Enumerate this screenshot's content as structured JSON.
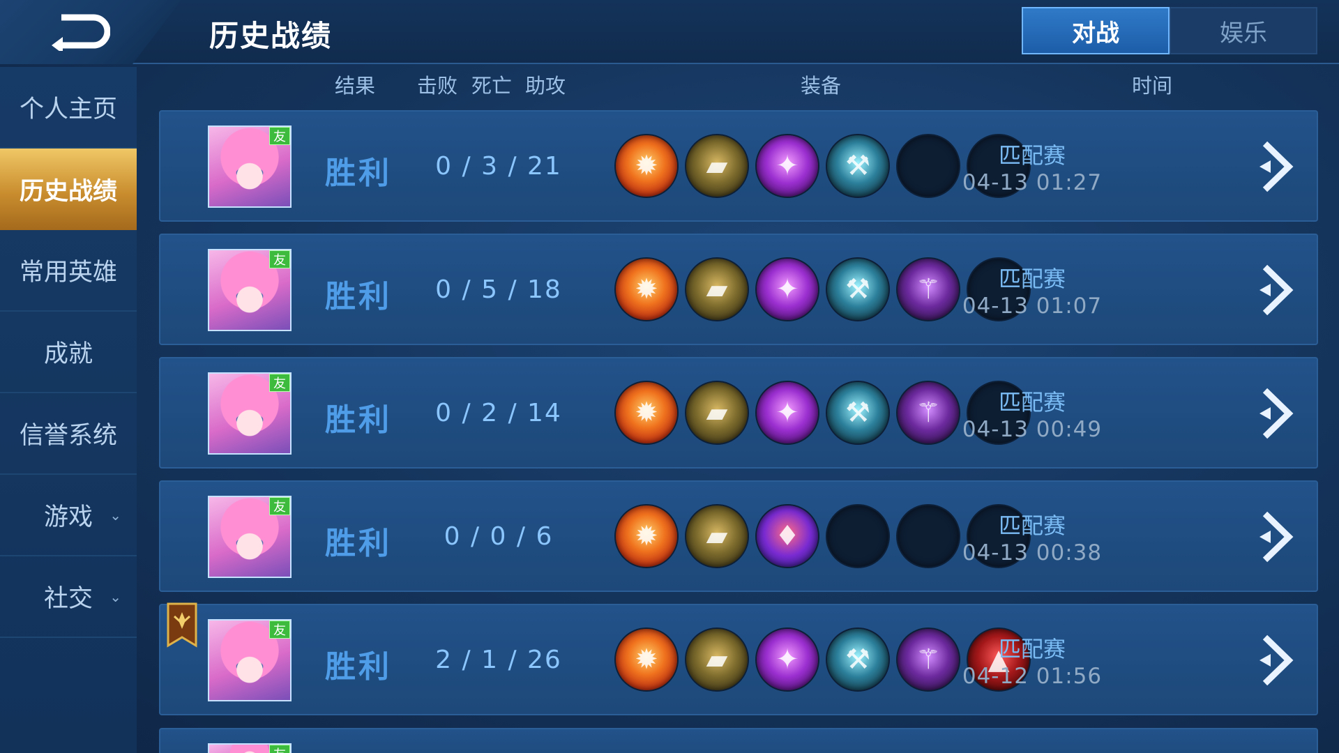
{
  "header": {
    "title": "历史战绩"
  },
  "tabs": [
    {
      "label": "对战",
      "active": true
    },
    {
      "label": "娱乐",
      "active": false
    }
  ],
  "sidebar": {
    "items": [
      {
        "label": "个人主页",
        "active": false,
        "has_chevron": false
      },
      {
        "label": "历史战绩",
        "active": true,
        "has_chevron": false
      },
      {
        "label": "常用英雄",
        "active": false,
        "has_chevron": false
      },
      {
        "label": "成就",
        "active": false,
        "has_chevron": false
      },
      {
        "label": "信誉系统",
        "active": false,
        "has_chevron": false
      },
      {
        "label": "游戏",
        "active": false,
        "has_chevron": true
      },
      {
        "label": "社交",
        "active": false,
        "has_chevron": true
      }
    ]
  },
  "columns": {
    "result": "结果",
    "kills": "击败",
    "deaths": "死亡",
    "assists": "助攻",
    "items": "装备",
    "time": "时间"
  },
  "friend_badge": "友",
  "matches": [
    {
      "result": "胜利",
      "kda": "0 / 3 / 21",
      "mode": "匹配赛",
      "time": "04-13  01:27",
      "mvp": false,
      "items": [
        "fire-orb",
        "boots",
        "purple-scepter",
        "ice-axe",
        "empty",
        "empty"
      ]
    },
    {
      "result": "胜利",
      "kda": "0 / 5 / 18",
      "mode": "匹配赛",
      "time": "04-13  01:07",
      "mvp": false,
      "items": [
        "fire-orb",
        "boots",
        "purple-scepter",
        "ice-axe",
        "dark-staff",
        "empty"
      ]
    },
    {
      "result": "胜利",
      "kda": "0 / 2 / 14",
      "mode": "匹配赛",
      "time": "04-13  00:49",
      "mvp": false,
      "items": [
        "fire-orb",
        "boots",
        "purple-scepter",
        "ice-axe",
        "dark-staff",
        "empty"
      ]
    },
    {
      "result": "胜利",
      "kda": "0 / 0 / 6",
      "mode": "匹配赛",
      "time": "04-13  00:38",
      "mvp": false,
      "items": [
        "fire-orb",
        "boots",
        "ruby-wand",
        "empty",
        "empty",
        "empty"
      ]
    },
    {
      "result": "胜利",
      "kda": "2 / 1 / 26",
      "mode": "匹配赛",
      "time": "04-12  01:56",
      "mvp": true,
      "items": [
        "fire-orb",
        "boots",
        "purple-scepter",
        "ice-axe",
        "dark-staff",
        "wizard-hat"
      ]
    }
  ],
  "item_styles": {
    "fire-orb": {
      "bg": "radial-gradient(circle at 50% 45%, #ffcf6a 0%, #f0731e 40%, #b3220f 80%, #5e0d06 100%)",
      "glyph": "✹"
    },
    "boots": {
      "bg": "radial-gradient(circle at 50% 45%, #d8b863 0%, #7b6a2c 45%, #3a3216 85%)",
      "glyph": "▰"
    },
    "purple-scepter": {
      "bg": "radial-gradient(circle at 50% 45%, #f39bff 0%, #9b2fd0 45%, #3f0c5e 90%)",
      "glyph": "✦"
    },
    "ice-axe": {
      "bg": "radial-gradient(circle at 50% 45%, #9ef3ff 0%, #2c7f9a 45%, #0d2a38 90%)",
      "glyph": "⚒"
    },
    "dark-staff": {
      "bg": "radial-gradient(circle at 50% 45%, #d38dff 0%, #6c2a9e 45%, #27103f 90%)",
      "glyph": "⚚"
    },
    "ruby-wand": {
      "bg": "radial-gradient(circle at 50% 45%, #ff6a86 0%, #7a2bd2 50%, #2b1a7a 90%)",
      "glyph": "♦"
    },
    "wizard-hat": {
      "bg": "radial-gradient(circle at 50% 45%, #ff5a5a 0%, #a4181a 45%, #3f0505 90%)",
      "glyph": "▲"
    }
  }
}
